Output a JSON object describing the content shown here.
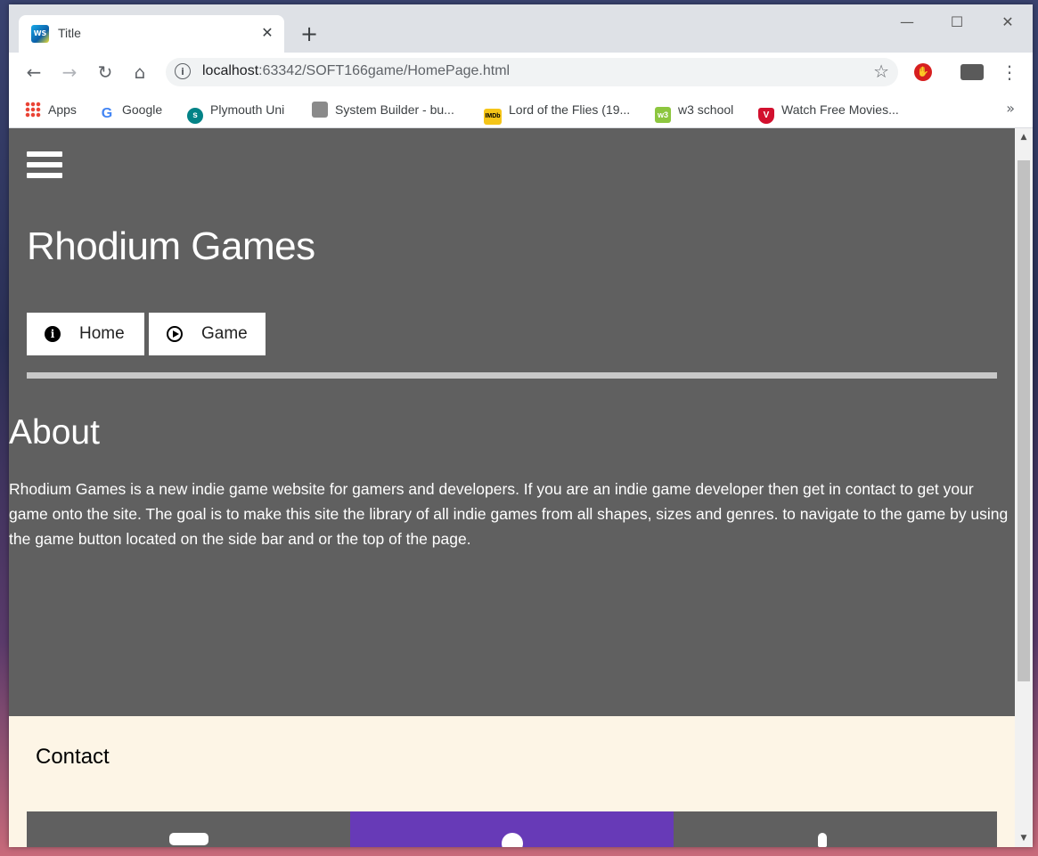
{
  "browser": {
    "tab_title": "Title",
    "tab_favicon_text": "WS",
    "url_host": "localhost",
    "url_rest": ":63342/SOFT166game/HomePage.html",
    "bookmarks": [
      {
        "label": "Apps",
        "icon": "apps-grid-icon"
      },
      {
        "label": "Google",
        "icon": "google-icon"
      },
      {
        "label": "Plymouth Uni",
        "icon": "sharepoint-icon"
      },
      {
        "label": "System Builder - bu...",
        "icon": "box-icon"
      },
      {
        "label": "Lord of the Flies (19...",
        "icon": "imdb-icon",
        "icon_text": "IMDb"
      },
      {
        "label": "w3 school",
        "icon": "w3schools-icon",
        "icon_text": "w3"
      },
      {
        "label": "Watch Free Movies...",
        "icon": "shield-logo-icon"
      }
    ]
  },
  "page": {
    "site_title": "Rhodium Games",
    "nav_buttons": [
      {
        "label": "Home",
        "icon": "info-icon"
      },
      {
        "label": "Game",
        "icon": "play-circle-icon"
      }
    ],
    "about_heading": "About",
    "about_text": "Rhodium Games is a new indie game website for gamers and developers. If you are an indie game developer then get in contact to get your game onto the site. The goal is to make this site the library of all indie games from all shapes, sizes and genres. to navigate to the game by using the game button located on the side bar and or the top of the page.",
    "contact_heading": "Contact",
    "contact_cards": [
      {
        "icon": "envelope-icon",
        "color": "#606060"
      },
      {
        "icon": "map-marker-icon",
        "color": "#673ab7"
      },
      {
        "icon": "phone-icon",
        "color": "#606060"
      }
    ]
  },
  "colors": {
    "page_background": "#606060",
    "contact_background": "#fdf5e6",
    "accent_purple": "#673ab7"
  }
}
